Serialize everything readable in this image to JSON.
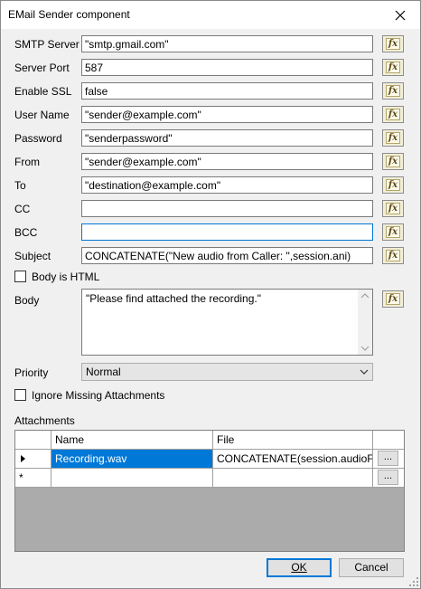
{
  "window": {
    "title": "EMail Sender component"
  },
  "fields": [
    {
      "label": "SMTP Server",
      "value": "\"smtp.gmail.com\""
    },
    {
      "label": "Server Port",
      "value": "587"
    },
    {
      "label": "Enable SSL",
      "value": "false"
    },
    {
      "label": "User Name",
      "value": "\"sender@example.com\""
    },
    {
      "label": "Password",
      "value": "\"senderpassword\""
    },
    {
      "label": "From",
      "value": "\"sender@example.com\""
    },
    {
      "label": "To",
      "value": "\"destination@example.com\""
    },
    {
      "label": "CC",
      "value": ""
    },
    {
      "label": "BCC",
      "value": ""
    },
    {
      "label": "Subject",
      "value": "CONCATENATE(\"New audio from Caller: \",session.ani)"
    }
  ],
  "fx_label": "fx",
  "body_is_html": {
    "label": "Body is HTML",
    "checked": false
  },
  "body": {
    "label": "Body",
    "value": "\"Please find attached the recording.\""
  },
  "priority": {
    "label": "Priority",
    "value": "Normal"
  },
  "ignore_missing": {
    "label": "Ignore Missing Attachments",
    "checked": false
  },
  "attachments": {
    "label": "Attachments",
    "columns": [
      "Name",
      "File"
    ],
    "rows": [
      {
        "name": "Recording.wav",
        "file": "CONCATENATE(session.audioFol..."
      }
    ],
    "new_row_marker": "*",
    "browse_label": "..."
  },
  "buttons": {
    "ok": "OK",
    "cancel": "Cancel"
  }
}
